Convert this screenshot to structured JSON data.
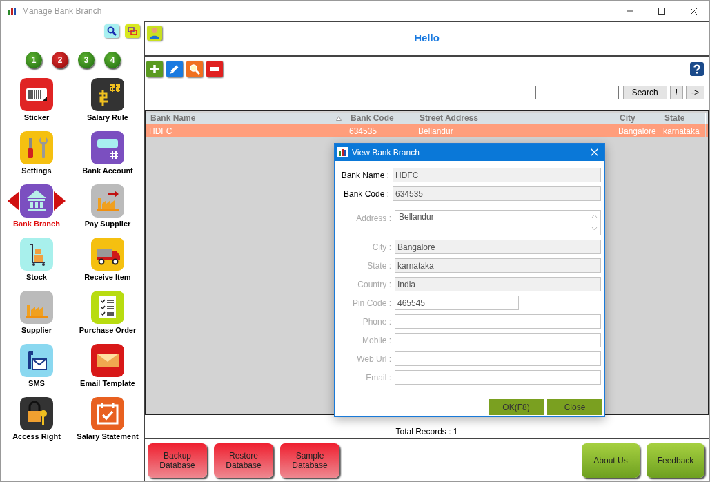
{
  "window": {
    "title": "Manage Bank Branch"
  },
  "sidebar": {
    "pages": [
      {
        "label": "1",
        "selected": false
      },
      {
        "label": "2",
        "selected": true
      },
      {
        "label": "3",
        "selected": false
      },
      {
        "label": "4",
        "selected": false
      }
    ],
    "items": [
      {
        "label": "Sticker",
        "selected": false
      },
      {
        "label": "Salary Rule",
        "selected": false
      },
      {
        "label": "Settings",
        "selected": false
      },
      {
        "label": "Bank Account",
        "selected": false
      },
      {
        "label": "Bank Branch",
        "selected": true
      },
      {
        "label": "Pay Supplier",
        "selected": false
      },
      {
        "label": "Stock",
        "selected": false
      },
      {
        "label": "Receive Item",
        "selected": false
      },
      {
        "label": "Supplier",
        "selected": false
      },
      {
        "label": "Purchase Order",
        "selected": false
      },
      {
        "label": "SMS",
        "selected": false
      },
      {
        "label": "Email Template",
        "selected": false
      },
      {
        "label": "Access Right",
        "selected": false
      },
      {
        "label": "Salary Statement",
        "selected": false
      }
    ]
  },
  "header": {
    "greeting": "Hello"
  },
  "search": {
    "button": "Search",
    "extra_buttons": [
      "!",
      "->"
    ]
  },
  "table": {
    "columns": [
      {
        "label": "Bank Name",
        "sorted": true
      },
      {
        "label": "Bank Code",
        "sorted": false
      },
      {
        "label": "Street Address",
        "sorted": false
      },
      {
        "label": "City",
        "sorted": false
      },
      {
        "label": "State",
        "sorted": false
      }
    ],
    "rows": [
      {
        "selected": true,
        "cells": [
          "HDFC",
          "634535",
          "Bellandur",
          "Bangalore",
          "karnataka"
        ]
      }
    ]
  },
  "total_records": "Total Records : 1",
  "bottom_buttons": [
    {
      "label": "Backup\nDatabase",
      "kind": "red"
    },
    {
      "label": "Restore\nDatabase",
      "kind": "red"
    },
    {
      "label": "Sample\nDatabase",
      "kind": "red"
    },
    {
      "label": "About Us",
      "kind": "green"
    },
    {
      "label": "Feedback",
      "kind": "green"
    }
  ],
  "dialog": {
    "title": "View Bank Branch",
    "fields": [
      {
        "label": "Bank Name :",
        "value": "HDFC",
        "required": true,
        "readonly": true,
        "kind": "wide"
      },
      {
        "label": "Bank Code :",
        "value": "634535",
        "required": true,
        "readonly": true,
        "kind": "wide"
      },
      {
        "label": "Address :",
        "value": "Bellandur",
        "required": false,
        "readonly": false,
        "kind": "textarea"
      },
      {
        "label": "City :",
        "value": "Bangalore",
        "required": false,
        "readonly": true,
        "kind": "line"
      },
      {
        "label": "State :",
        "value": "karnataka",
        "required": false,
        "readonly": true,
        "kind": "line"
      },
      {
        "label": "Country :",
        "value": "India",
        "required": false,
        "readonly": true,
        "kind": "line"
      },
      {
        "label": "Pin Code :",
        "value": "465545",
        "required": false,
        "readonly": false,
        "kind": "short"
      },
      {
        "label": "Phone :",
        "required": false,
        "readonly": false,
        "kind": "line"
      },
      {
        "label": "Mobile :",
        "required": false,
        "readonly": false,
        "kind": "line"
      },
      {
        "label": "Web Url :",
        "required": false,
        "readonly": false,
        "kind": "line"
      },
      {
        "label": "Email :",
        "required": false,
        "readonly": false,
        "kind": "line"
      }
    ],
    "buttons": [
      "OK(F8)",
      "Close"
    ]
  }
}
